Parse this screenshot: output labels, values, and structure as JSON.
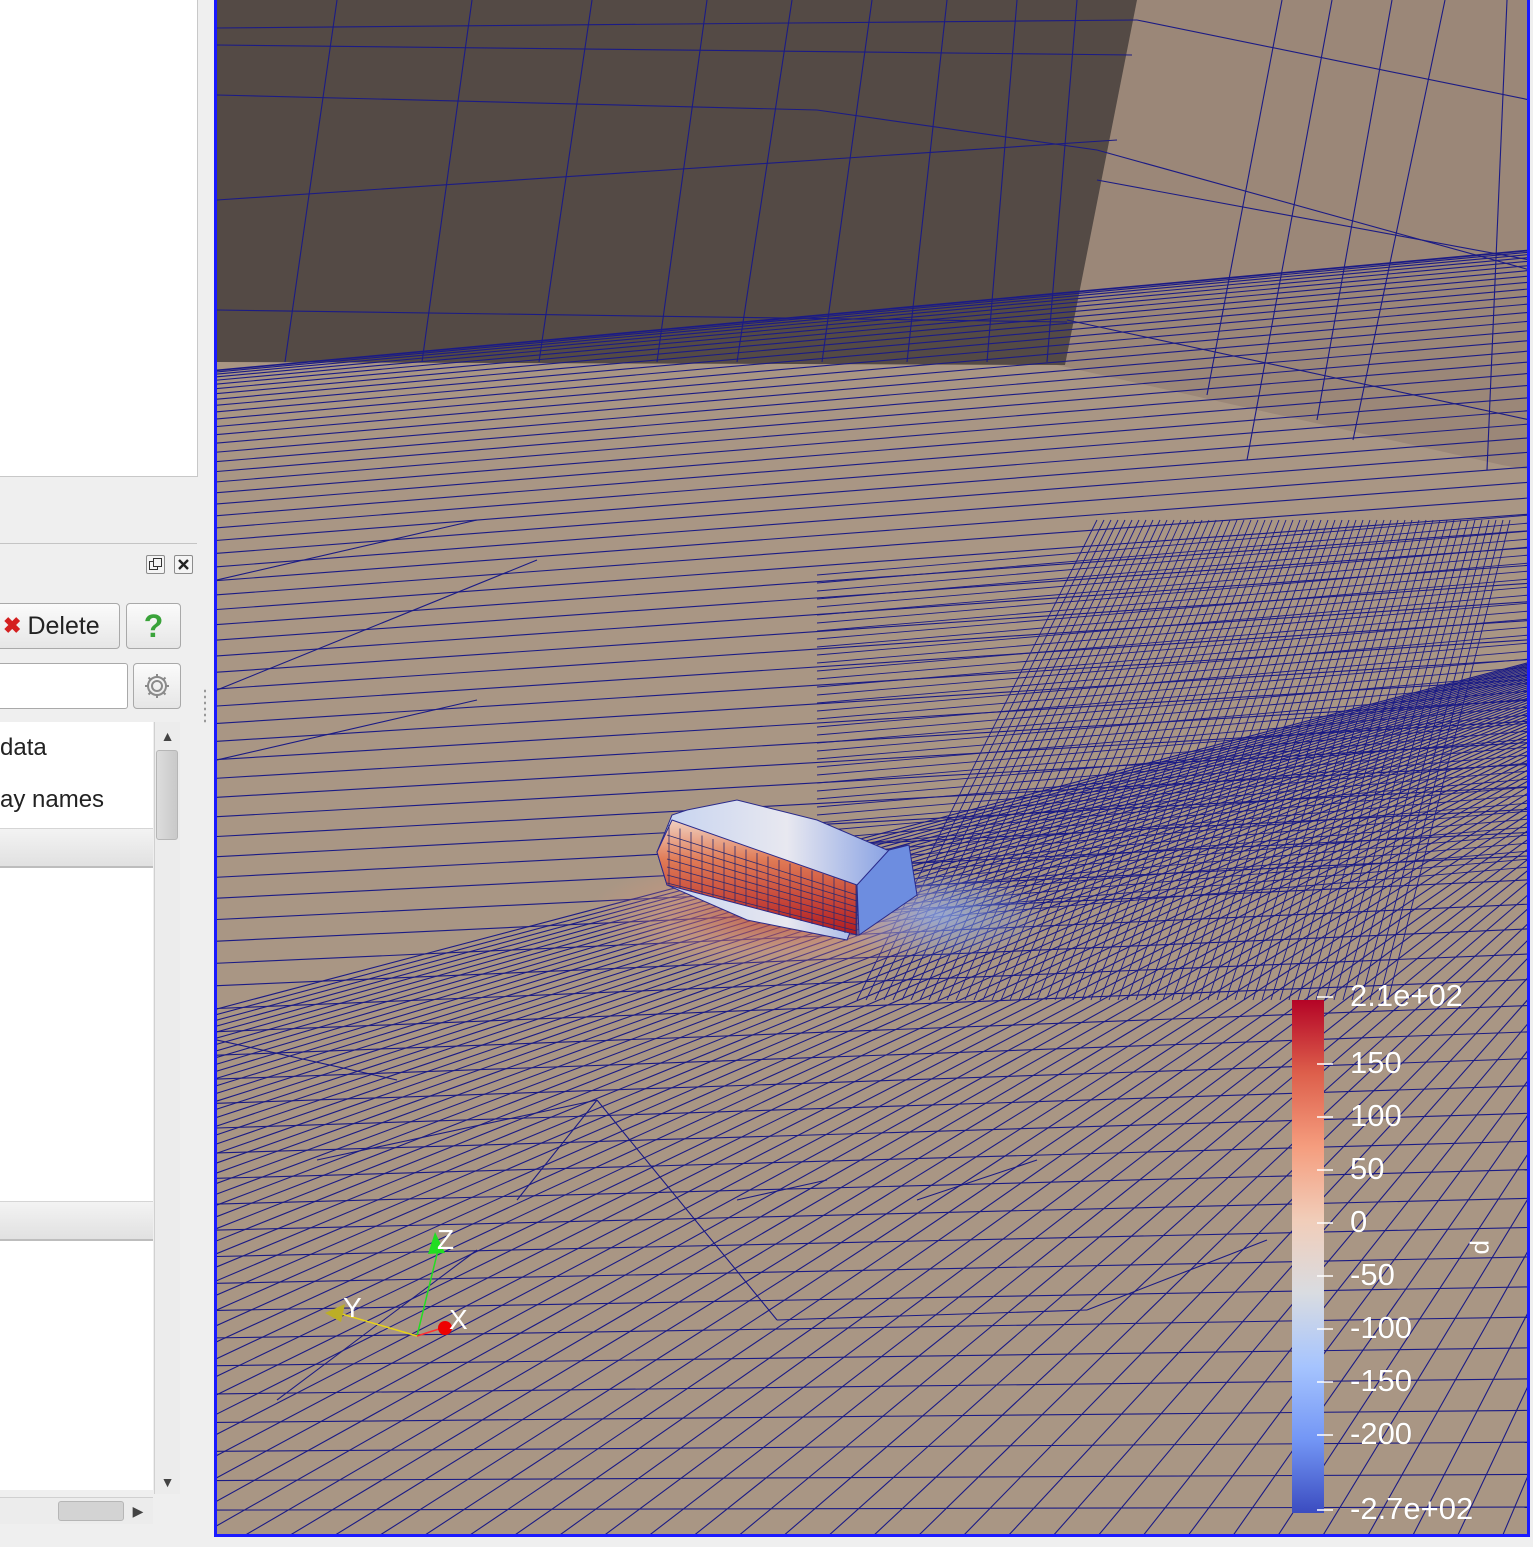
{
  "panel": {
    "delete_label": "Delete",
    "help_label": "?",
    "search_value": "",
    "rows": [
      "data",
      "ay names"
    ]
  },
  "colorbar": {
    "array_name": "p",
    "max_label": "2.1e+02",
    "min_label": "-2.7e+02",
    "ticks": [
      "150",
      "100",
      "50",
      "0",
      "-50",
      "-100",
      "-150",
      "-200"
    ],
    "colors": [
      "#b40426",
      "#dd5f4b",
      "#f59d7e",
      "#f1cdb9",
      "#d9dce1",
      "#a6c4fe",
      "#7396f5",
      "#3b4cc0"
    ]
  },
  "axes": {
    "x": "X",
    "y": "Y",
    "z": "Z",
    "x_color": "#ff1a1a",
    "y_color": "#e6d21a",
    "z_color": "#22dd22"
  },
  "scene": {
    "wall_color": "#544a45",
    "surface_color": "#a99684",
    "mesh_color": "#1b1b85"
  }
}
